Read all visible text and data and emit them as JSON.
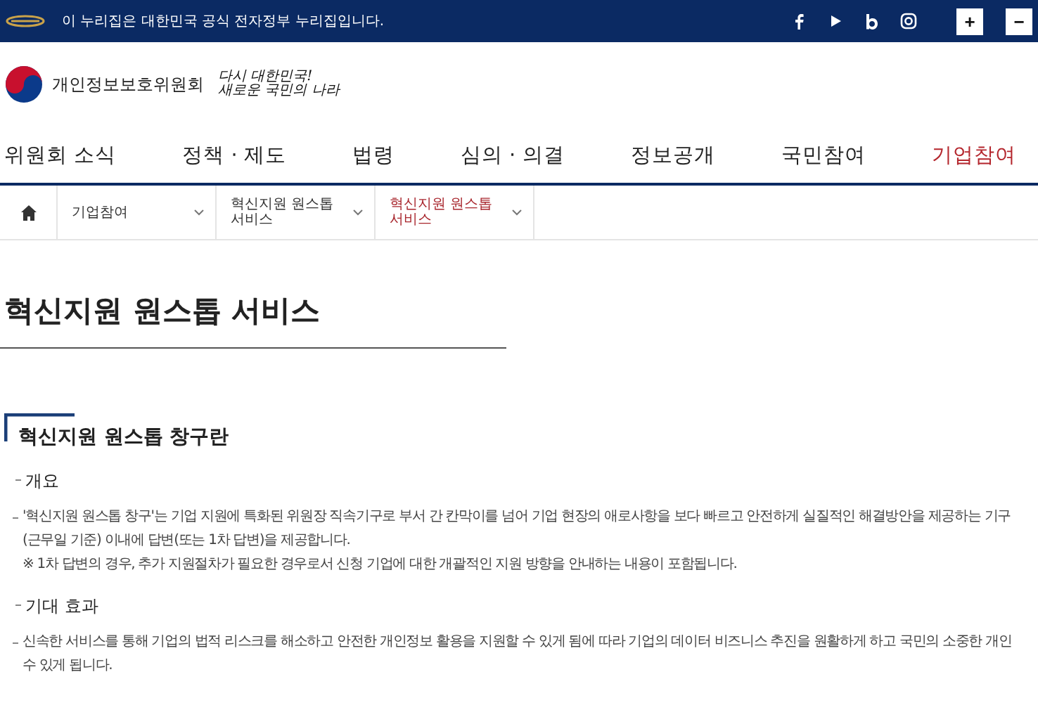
{
  "top_bar": {
    "notice": "이 누리집은 대한민국 공식 전자정부 누리집입니다.",
    "zoom_buttons": [
      "+",
      "−"
    ]
  },
  "header": {
    "org_name": "개인정보보호위원회",
    "slogan_lines": [
      "다시 대한민국!",
      "새로운 국민의 나라"
    ]
  },
  "nav": [
    {
      "label": "위원회 소식",
      "selected": false
    },
    {
      "label": "정책 · 제도",
      "selected": false
    },
    {
      "label": "법령",
      "selected": false
    },
    {
      "label": "심의 · 의결",
      "selected": false
    },
    {
      "label": "정보공개",
      "selected": false
    },
    {
      "label": "국민참여",
      "selected": false
    },
    {
      "label": "기업참여",
      "selected": true
    }
  ],
  "breadcrumb": [
    {
      "label": "기업참여",
      "selected": false
    },
    {
      "label": "혁신지원 원스톱 서비스",
      "selected": false
    },
    {
      "label": "혁신지원 원스톱 서비스",
      "selected": true
    }
  ],
  "page_title": "혁신지원 원스톱 서비스",
  "section_title": "혁신지원 원스톱 창구란",
  "blocks": [
    {
      "heading": "개요",
      "items": [
        {
          "lines": [
            "'혁신지원 원스톱 창구'는 기업 지원에 특화된 위원장 직속기구로 부서 간 칸막이를 넘어 기업 현장의 애로사항을 보다 빠르고 안전하게 실질적인 해결방안을 제공하는 기구",
            "(근무일 기준) 이내에 답변(또는 1차 답변)을 제공합니다.",
            "※ 1차 답변의 경우, 추가 지원절차가 필요한 경우로서 신청 기업에 대한 개괄적인 지원 방향을 안내하는 내용이 포함됩니다."
          ]
        }
      ]
    },
    {
      "heading": "기대 효과",
      "items": [
        {
          "lines": [
            "신속한 서비스를 통해 기업의 법적 리스크를 해소하고 안전한 개인정보 활용을 지원할 수 있게 됨에 따라 기업의 데이터 비즈니스 추진을 원활하게 하고 국민의 소중한 개인",
            "수 있게 됩니다."
          ]
        }
      ]
    }
  ]
}
